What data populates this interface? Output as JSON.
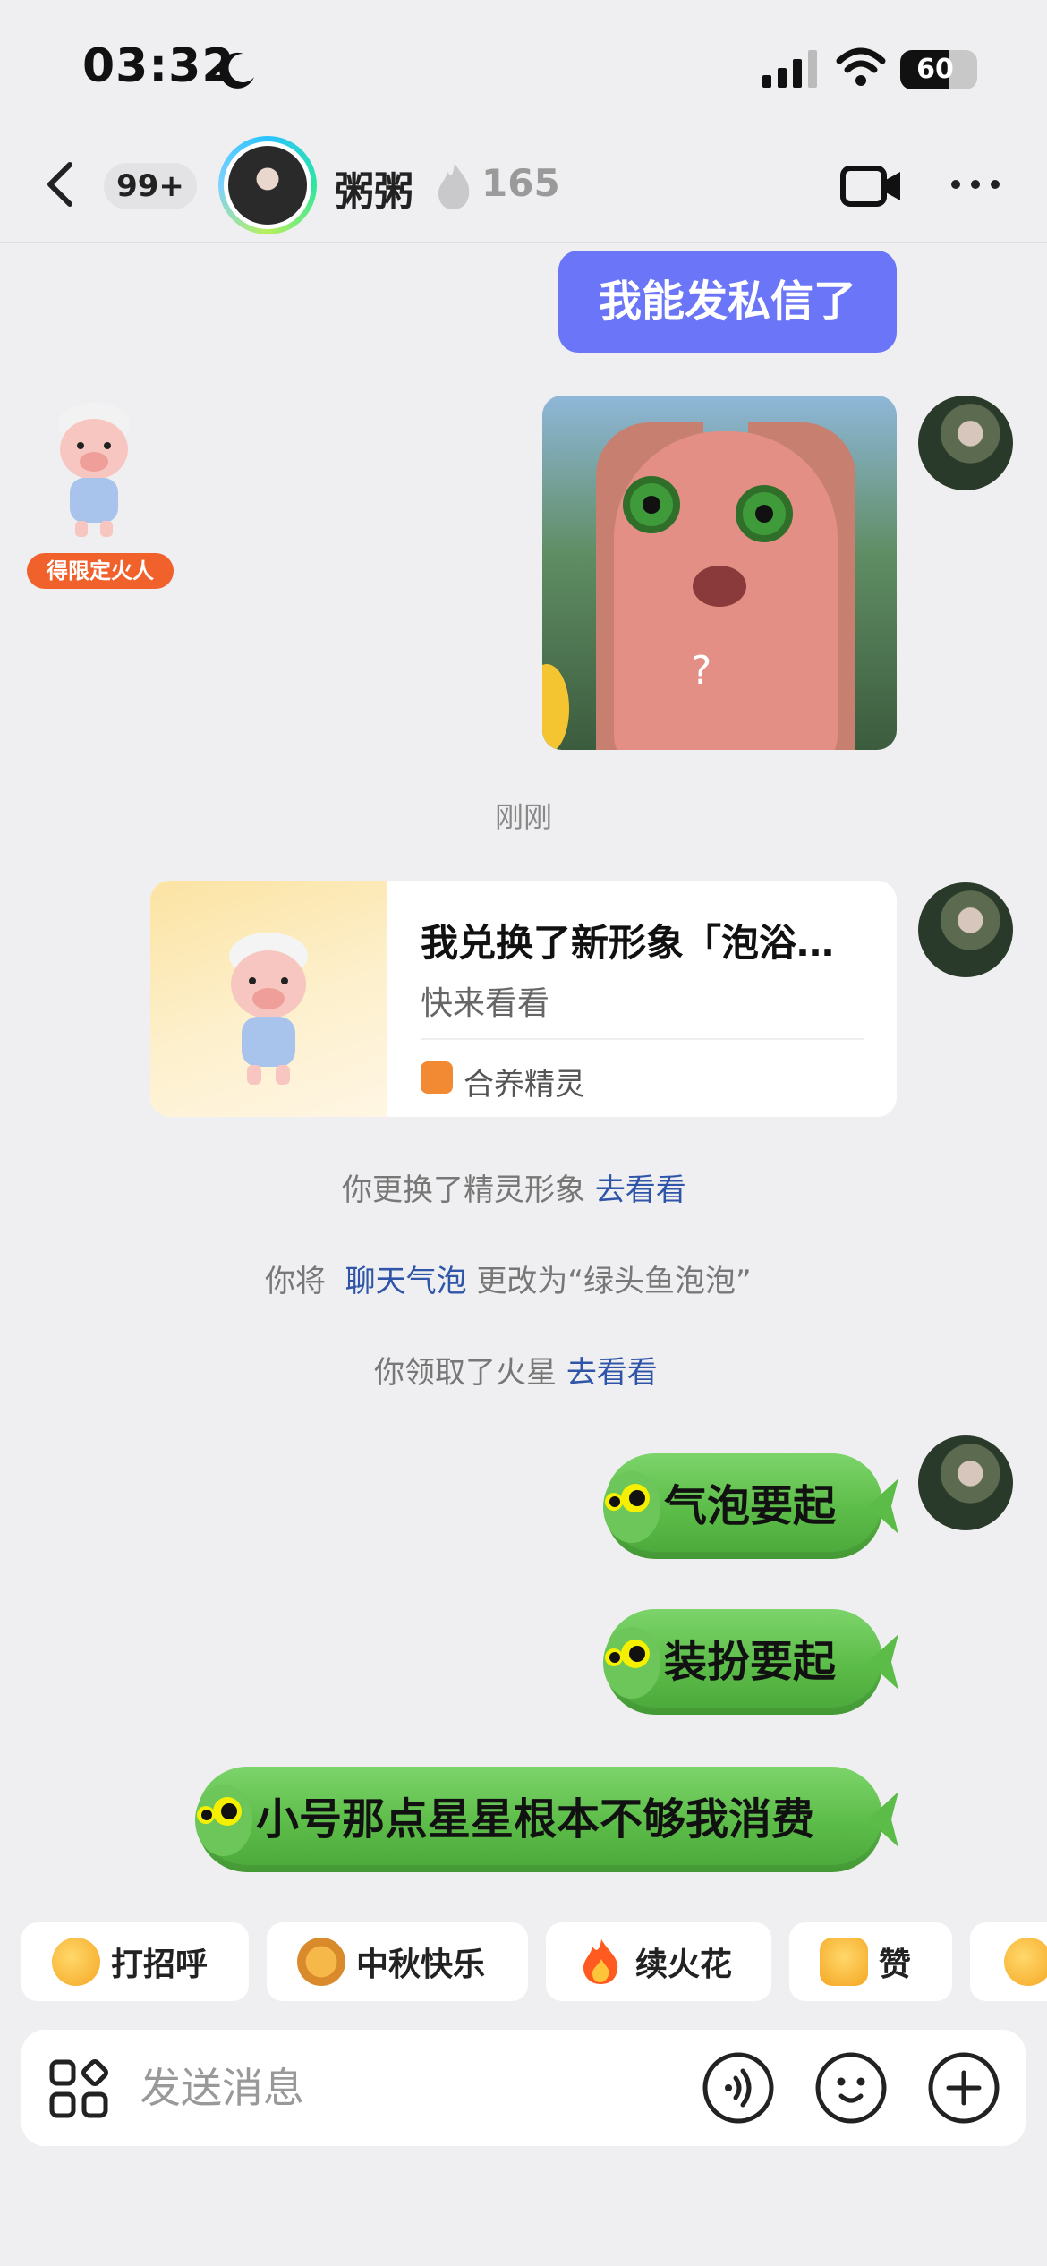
{
  "status_bar": {
    "time": "03:32",
    "battery": "60"
  },
  "header": {
    "unread_count": "99+",
    "contact_name": "粥粥",
    "flame_count": "165"
  },
  "messages": {
    "text_1": "我能发私信了",
    "sticker_caption": "?",
    "spirit_badge": "得限定火人",
    "time_label": "刚刚",
    "card": {
      "title": "我兑换了新形象「泡浴…",
      "subtitle": "快来看看",
      "app_name": "合养精灵"
    },
    "system_1": {
      "text": "你更换了精灵形象",
      "link": "去看看"
    },
    "system_2": {
      "prefix": "你将",
      "link": "聊天气泡",
      "suffix": "更改为“绿头鱼泡泡”"
    },
    "system_3": {
      "text": "你领取了火星",
      "link": "去看看"
    },
    "fish_1": "气泡要起",
    "fish_2": "装扮要起",
    "fish_3": "小号那点星星根本不够我消费"
  },
  "quick_replies": [
    "打招呼",
    "中秋快乐",
    "续火花",
    "赞",
    ""
  ],
  "input": {
    "placeholder": "发送消息"
  }
}
